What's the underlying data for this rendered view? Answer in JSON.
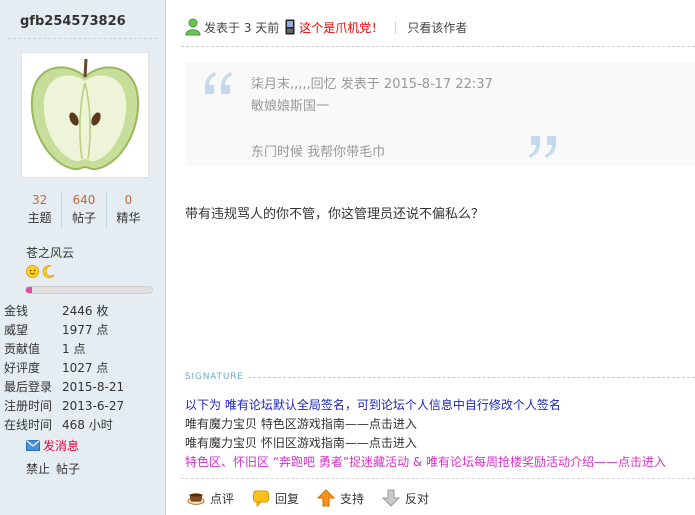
{
  "user": {
    "username": "gfb254573826",
    "stats": [
      {
        "value": "32",
        "label": "主题"
      },
      {
        "value": "640",
        "label": "帖子"
      },
      {
        "value": "0",
        "label": "精华"
      }
    ],
    "group": "苍之风云",
    "level_progress": 0.05,
    "info": [
      {
        "key": "金钱",
        "value": "2446 枚"
      },
      {
        "key": "威望",
        "value": "1977 点"
      },
      {
        "key": "贡献值",
        "value": "1 点"
      },
      {
        "key": "好评度",
        "value": "1027 点"
      },
      {
        "key": "最后登录",
        "value": "2015-8-21"
      },
      {
        "key": "注册时间",
        "value": "2013-6-27"
      },
      {
        "key": "在线时间",
        "value": "468 小时"
      }
    ],
    "send_message": "发消息",
    "ban_label": "禁止",
    "posts_label": "帖子"
  },
  "post": {
    "posted_prefix": "发表于",
    "posted_time": "3 天前",
    "mobile_text": "这个是爪机党！",
    "only_author": "只看该作者",
    "quote": {
      "header": "柒月末,,,,,回忆 发表于 2015-8-17 22:37",
      "line1": "敏娘娘斯国一",
      "line2": "东门时候 我帮你带毛巾"
    },
    "body": "带有违规骂人的你不管，你这管理员还说不偏私么？"
  },
  "signature": {
    "heading": "SIGNATURE",
    "line1": "以下为 唯有论坛默认全局签名，可到论坛个人信息中自行修改个人签名",
    "line2": "唯有魔力宝贝 特色区游戏指南——点击进入",
    "line3": "唯有魔力宝贝 怀旧区游戏指南——点击进入",
    "line4": "特色区、怀旧区 “奔跑吧 勇者”捉迷藏活动 & 唯有论坛每周抢楼奖励活动介绍——点击进入"
  },
  "actions": {
    "comment": "点评",
    "reply": "回复",
    "support": "支持",
    "oppose": "反对"
  },
  "colors": {
    "sidebar_bg": "#e5edf2",
    "stat_number": "#cc6633",
    "alert_red": "#ee0000",
    "sig_blue": "#1d26b8",
    "sig_pink": "#d433c9",
    "progress_pink": "#e24a9a"
  },
  "icons": {
    "online": "online-user-icon",
    "mobile": "mobile-phone-icon",
    "quote_open": "quote-open-icon",
    "quote_close": "quote-close-icon",
    "message": "envelope-icon",
    "comment": "coffee-cup-icon",
    "reply": "speech-bubble-icon",
    "support": "thumb-up-arrow-icon",
    "oppose": "thumb-down-arrow-icon"
  }
}
